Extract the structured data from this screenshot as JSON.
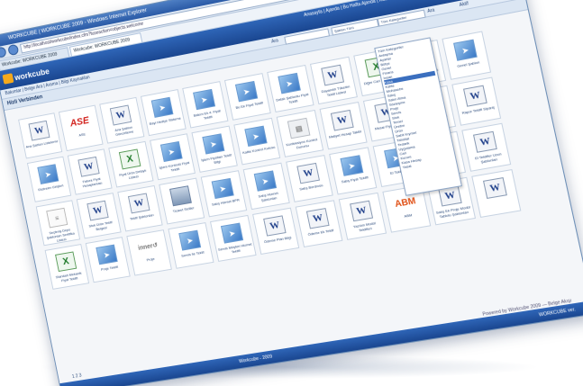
{
  "browser": {
    "title": "WORKCUBE | WORKCUBE 2009 - Windows Internet Explorer",
    "url": "http://localhost/workcube/index.cfm?fuseaction=objects.welcome",
    "tabs": [
      {
        "label": "Workcube: WORKCUBE 2009"
      },
      {
        "label": "Workcube: WORKCUBE 2009"
      }
    ],
    "search_label": "Yahoo! Search"
  },
  "app": {
    "logo_text": "workcube",
    "topnav": "Anasayfa | Ajanda | Bu Hafta Ajanda | Kutusu | Online Mesaj | Ara | Ağınız Gelen | Ayarlar | Çıkış | Yardım",
    "menu": "Bakımlar | Belge Ara | Arama | Bilgi Kaynakları",
    "page_title": "Hizli Verbinden",
    "toolbar_note": "Ara",
    "toolbar_filter": "Şablon Türü",
    "toolbar_select": "Tüm Kategoriler",
    "toolbar_search": "Ara",
    "toolbar_aktiv": "Aktif"
  },
  "dropdown_items": [
    "Tüm Kategoriler",
    "Anlaşma",
    "Ayarlar",
    "Bütçe",
    "Genel",
    "Finans",
    "İnsan",
    "Kasa",
    "Kalite",
    "Muhasebe",
    "Satış",
    "Satın Alma",
    "Sözleşme",
    "Proje",
    "Servis",
    "Stok",
    "Temel",
    "Üretim",
    "Ürün",
    "Sabit Kıymet",
    "Tahsilat",
    "Tedarik",
    "Uygulama",
    "Cari",
    "Kurum",
    "Kasa Hesap",
    "Yasal"
  ],
  "selected_dropdown": "Kasa",
  "tiles": [
    {
      "type": "word",
      "label": "Ana Şablon Listeleme"
    },
    {
      "type": "ase",
      "label": "ASE"
    },
    {
      "type": "word",
      "label": "Ana Şablon Güncelleme"
    },
    {
      "type": "arrow",
      "label": "Bayi Hediye Sisteme"
    },
    {
      "type": "arrow",
      "label": "Bakım Ek 4. Fiyat Teklifi"
    },
    {
      "type": "arrow",
      "label": "Bu Ek Fiyat Teklifi"
    },
    {
      "type": "arrow",
      "label": "Datalı Şablonlu Fiyat Teklifi"
    },
    {
      "type": "word",
      "label": "Dayanıklı Tüketim Teklif Listesi"
    },
    {
      "type": "excel",
      "label": "Diğer Cari Yönetimi"
    },
    {
      "type": "pdf",
      "label": "Defter Fiyat Teklifi"
    },
    {
      "type": "arrow",
      "label": "Genel Şablon"
    },
    {
      "type": "arrow",
      "label": "Ekstreler Girişleri"
    },
    {
      "type": "word",
      "label": "Fatura Fiyat Hesaplaması"
    },
    {
      "type": "excel",
      "label": "Fiyat Ürün Detaylı Listesi"
    },
    {
      "type": "arrow",
      "label": "İşlem Kontrolü Fiyat Teklifi"
    },
    {
      "type": "arrow",
      "label": "İşlem Fiyatları Teklif Bilgi"
    },
    {
      "type": "arrow",
      "label": "Kalite Kontrol Kutusu"
    },
    {
      "type": "stack",
      "label": "Konfeksiyon Kontrol Durumu"
    },
    {
      "type": "word",
      "label": "Maliyet Hesap Takibi"
    },
    {
      "type": "word",
      "label": "Mesai Fiyat Teklifi"
    },
    {
      "type": "word",
      "label": "Mesai Teklif Fiyat Teklif"
    },
    {
      "type": "word",
      "label": "Rapor Teklifi Sipariş"
    },
    {
      "type": "doc",
      "label": "Seçilmiş Depo Şablonları Sertifika Listesi"
    },
    {
      "type": "word",
      "label": "Stok Ürün Teklif Belgesi"
    },
    {
      "type": "word",
      "label": "Teklif Şablonları"
    },
    {
      "type": "building",
      "label": "Ticaret Siciller"
    },
    {
      "type": "arrow",
      "label": "Satış Hizmet BPR"
    },
    {
      "type": "arrow",
      "label": "Satış Hizmet Şablonları"
    },
    {
      "type": "word",
      "label": "Satış Bordrosu"
    },
    {
      "type": "arrow",
      "label": "Satış Fiyat Teklifi"
    },
    {
      "type": "arrow",
      "label": "El Teklifleri"
    },
    {
      "type": "word",
      "label": "El Teklifler Uzun Şablonlar"
    },
    {
      "type": "word",
      "label": "El Teklifler Uzun Şablonları"
    },
    {
      "type": "excel",
      "label": "Standart Mekanik Fiyat Teklifi"
    },
    {
      "type": "arrow",
      "label": "Proje Teklifi"
    },
    {
      "type": "inner",
      "label": "Proje"
    },
    {
      "type": "arrow",
      "label": "Servis ile Teklif"
    },
    {
      "type": "arrow",
      "label": "Servis Müşteri Hizmet Teklifi"
    },
    {
      "type": "word",
      "label": "Ödeme Plan Bilgi"
    },
    {
      "type": "word",
      "label": "Ödeme Ek Teklif"
    },
    {
      "type": "word",
      "label": "Yazılım Modül Teklifleri"
    },
    {
      "type": "abm",
      "label": "ABM"
    },
    {
      "type": "word",
      "label": "Satış Ek Proje Modül Tablolu Şablonları"
    },
    {
      "type": "word",
      "label": ""
    }
  ],
  "footer": {
    "pager": "1 2 3",
    "credit": "Powered by Workcube 2009 — Belge Akışı",
    "status": "Workcube - 2009",
    "status_right": "WORKCUBE ver."
  }
}
